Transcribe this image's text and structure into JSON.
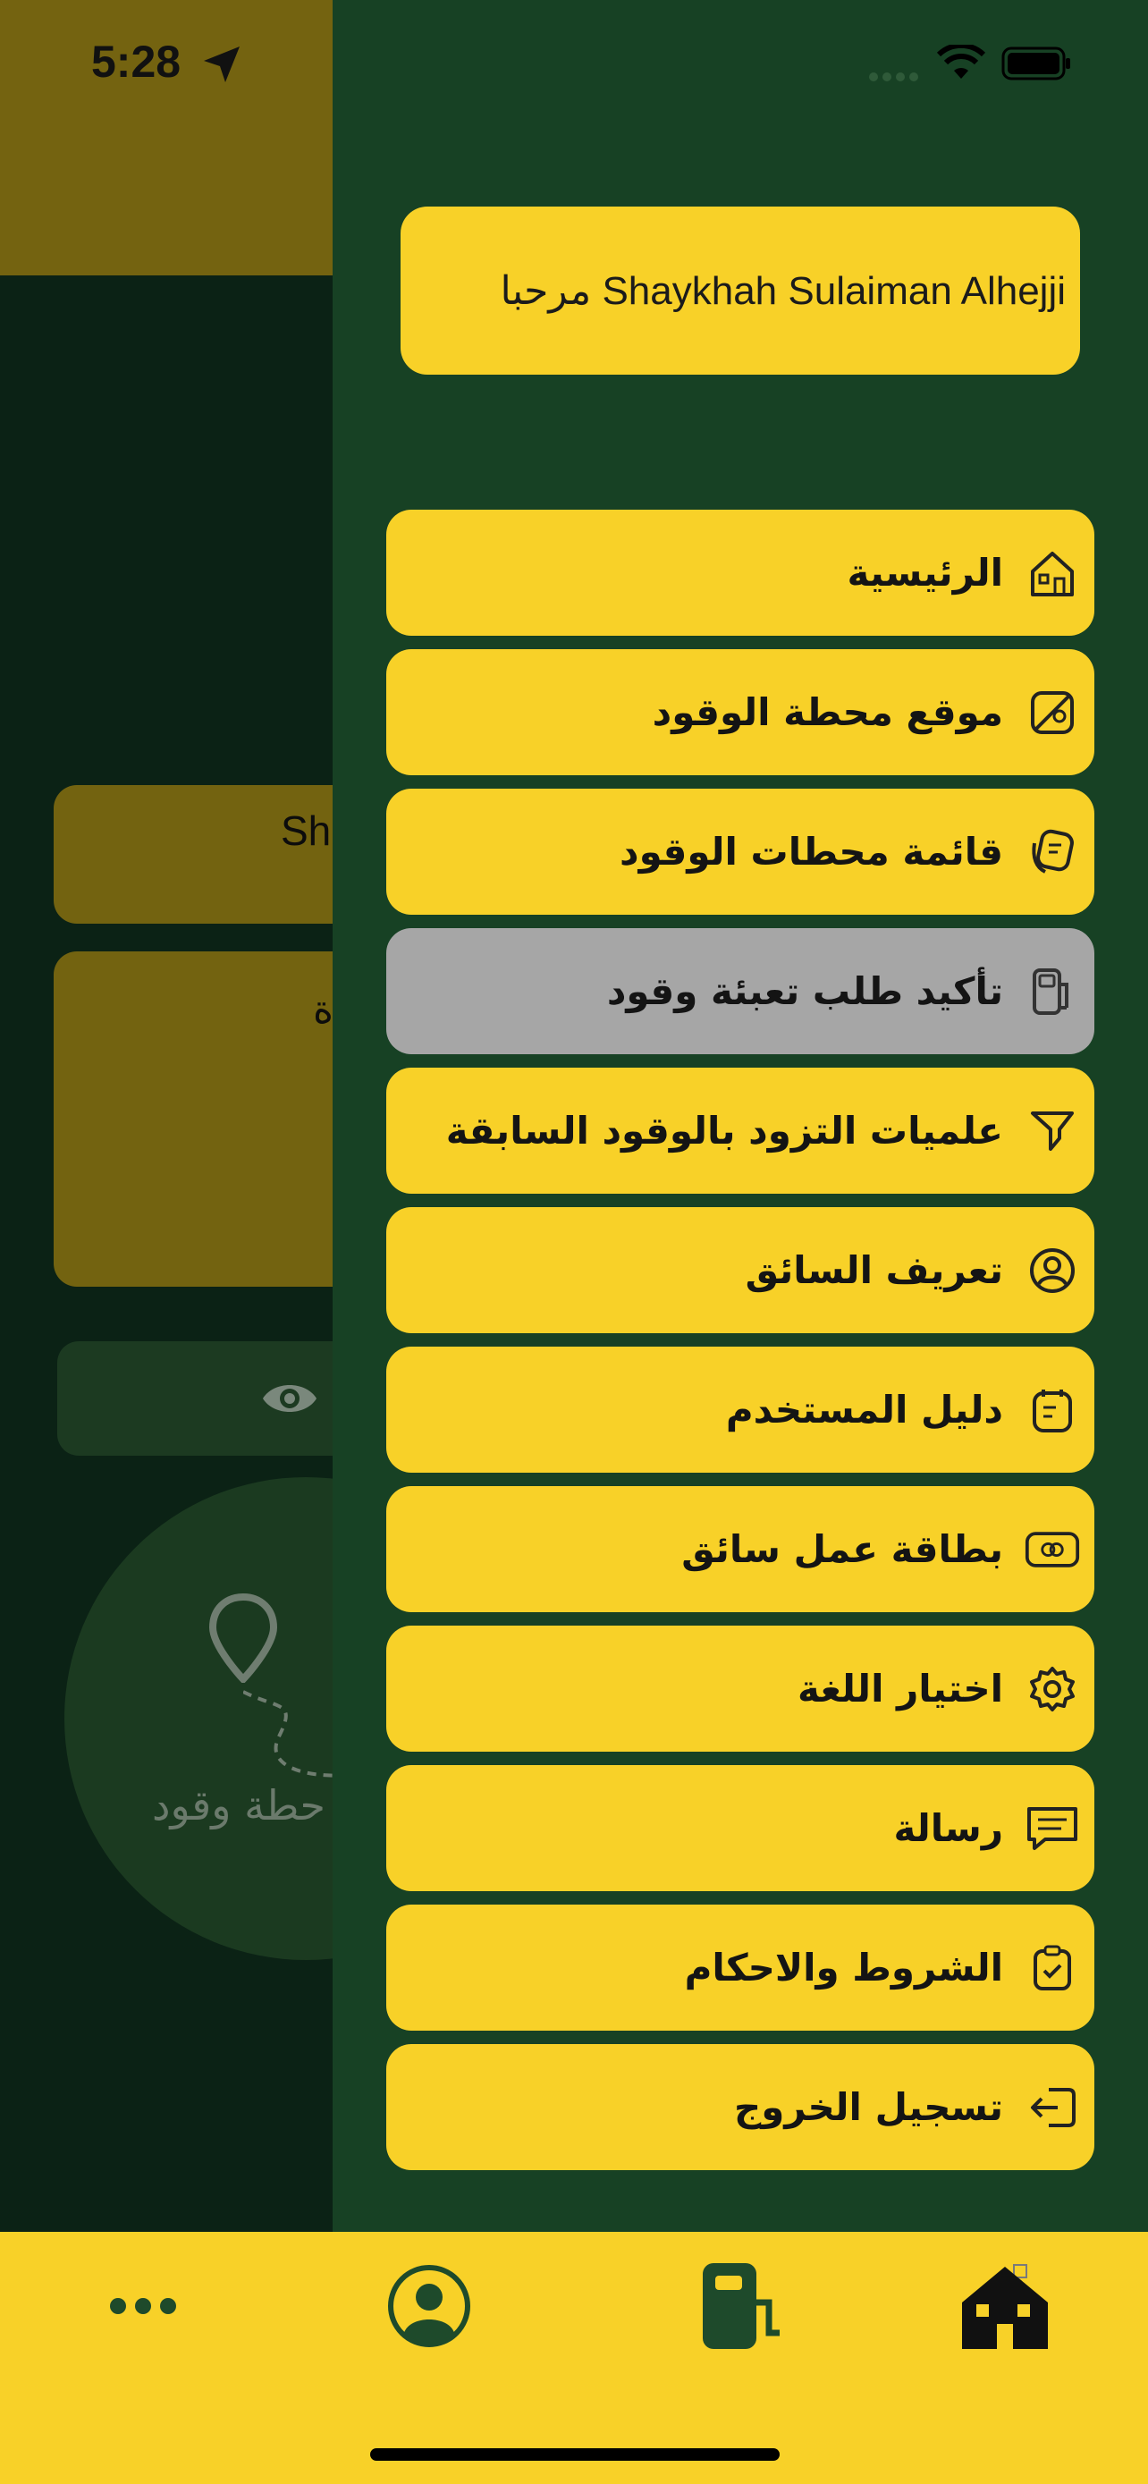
{
  "status_bar": {
    "time": "5:28"
  },
  "background_page": {
    "card_name_fragment": "Sh",
    "card_text_fragment": "ة",
    "station_label": "حطة وقود"
  },
  "drawer": {
    "welcome": "مرحبا Shaykhah Sulaiman Alhejji",
    "items": [
      {
        "label": "الرئيسية",
        "icon": "home-icon"
      },
      {
        "label": "موقع محطة الوقود",
        "icon": "map-icon"
      },
      {
        "label": "قائمة محطات الوقود",
        "icon": "list-icon"
      },
      {
        "label": "تأكيد طلب تعبئة وقود",
        "icon": "fuel-pump-icon",
        "active": true
      },
      {
        "label": "علميات التزود بالوقود السابقة",
        "icon": "funnel-icon"
      },
      {
        "label": "تعريف السائق",
        "icon": "user-circle-icon"
      },
      {
        "label": "دليل المستخدم",
        "icon": "guide-icon"
      },
      {
        "label": "بطاقة عمل سائق",
        "icon": "card-icon"
      },
      {
        "label": "اختيار اللغة",
        "icon": "gear-icon"
      },
      {
        "label": "رسالة",
        "icon": "message-icon"
      },
      {
        "label": "الشروط والاحكام",
        "icon": "clipboard-check-icon"
      },
      {
        "label": "تسجيل الخروج",
        "icon": "logout-icon"
      }
    ]
  },
  "tab_bar": {
    "tabs": [
      {
        "name": "more",
        "icon": "more-icon"
      },
      {
        "name": "profile",
        "icon": "profile-icon"
      },
      {
        "name": "fuel",
        "icon": "fuel-pump-icon"
      },
      {
        "name": "home",
        "icon": "home-icon",
        "active": true
      }
    ]
  },
  "colors": {
    "accent_yellow": "#f8d128",
    "drawer_green": "#174124",
    "active_item_gray": "#a6a6a6"
  }
}
